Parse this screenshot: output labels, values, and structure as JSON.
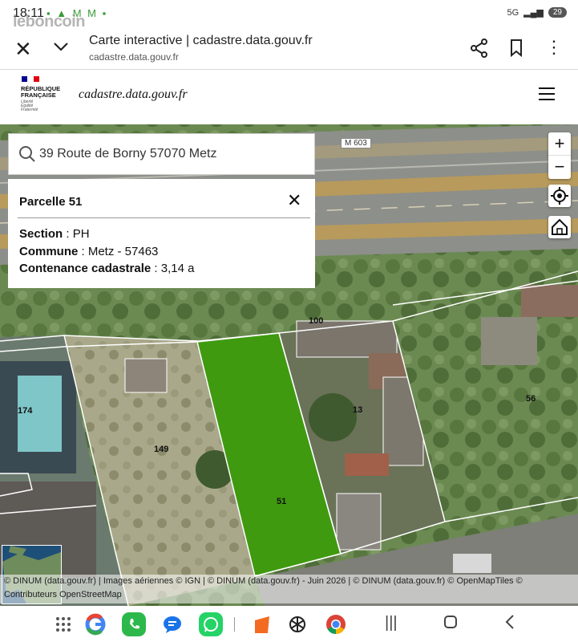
{
  "status_bar": {
    "time": "18:11",
    "network": "5G",
    "battery": "29",
    "watermark": "leboncoin"
  },
  "browser": {
    "title": "Carte interactive | cadastre.data.gouv.fr",
    "url": "cadastre.data.gouv.fr"
  },
  "site": {
    "republique": [
      "RÉPUBLIQUE",
      "FRANÇAISE"
    ],
    "motto": [
      "Liberté",
      "Égalité",
      "Fraternité"
    ],
    "logo": "cadastre.data.gouv.fr"
  },
  "search": {
    "value": "39 Route de Borny 57070 Metz"
  },
  "panel": {
    "title": "Parcelle 51",
    "section_label": "Section",
    "section_value": " : PH",
    "commune_label": "Commune",
    "commune_value": " : Metz - 57463",
    "contenance_label": "Contenance cadastrale",
    "contenance_value": " : 3,14 a"
  },
  "map": {
    "road_label": "M 603",
    "parcel_labels": [
      "100",
      "174",
      "149",
      "13",
      "56",
      "51"
    ],
    "selected_color": "#3f9a10",
    "attribution_line1": "© DINUM (data.gouv.fr) | Images aériennes © IGN | © DINUM (data.gouv.fr) - Juin 2026 | © DINUM (data.gouv.fr) © OpenMapTiles ©",
    "attribution_line2": "Contributeurs OpenStreetMap"
  },
  "nav": {
    "apps": [
      "apps-grid-icon",
      "google-icon",
      "phone-icon",
      "messages-icon",
      "whatsapp-icon",
      "orange-app-icon",
      "chatgpt-icon",
      "chrome-icon"
    ]
  }
}
